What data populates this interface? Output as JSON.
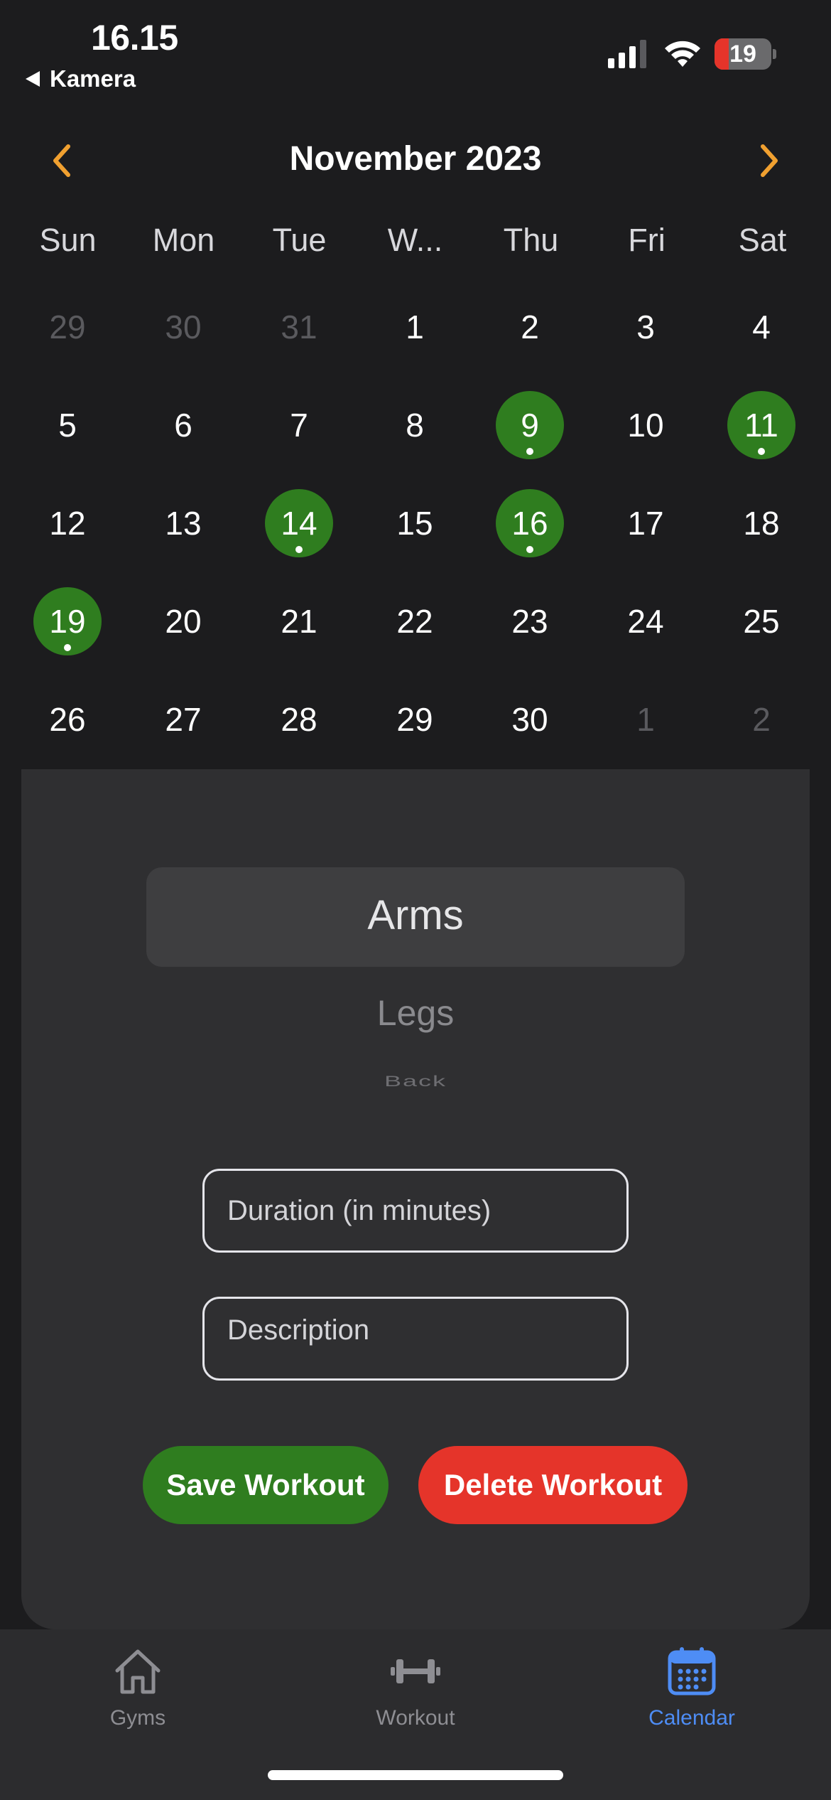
{
  "status_bar": {
    "time": "16.15",
    "back_app": "Kamera",
    "battery_level": "19"
  },
  "calendar": {
    "month_title": "November 2023",
    "accent_color": "#f0a030",
    "weekdays": [
      "Sun",
      "Mon",
      "Tue",
      "W...",
      "Thu",
      "Fri",
      "Sat"
    ],
    "weeks": [
      [
        "29",
        "30",
        "31",
        "1",
        "2",
        "3",
        "4"
      ],
      [
        "5",
        "6",
        "7",
        "8",
        "9",
        "10",
        "11"
      ],
      [
        "12",
        "13",
        "14",
        "15",
        "16",
        "17",
        "18"
      ],
      [
        "19",
        "20",
        "21",
        "22",
        "23",
        "24",
        "25"
      ],
      [
        "26",
        "27",
        "28",
        "29",
        "30",
        "1",
        "2"
      ]
    ],
    "outside_month_days": [
      "29-Oct",
      "30-Oct",
      "31-Oct",
      "1-Dec",
      "2-Dec"
    ],
    "workout_days": [
      "9",
      "11",
      "14",
      "16",
      "19"
    ],
    "workout_color": "#2f7d1f"
  },
  "workout_form": {
    "picker_options": [
      "Arms",
      "Legs",
      "Back"
    ],
    "selected_option": "Arms",
    "duration_placeholder": "Duration (in minutes)",
    "description_placeholder": "Description",
    "save_label": "Save Workout",
    "delete_label": "Delete Workout",
    "save_color": "#2f7d1f",
    "delete_color": "#e5342a"
  },
  "tab_bar": {
    "items": [
      {
        "label": "Gyms",
        "icon": "house-icon",
        "active": false
      },
      {
        "label": "Workout",
        "icon": "dumbbell-icon",
        "active": false
      },
      {
        "label": "Calendar",
        "icon": "calendar-icon",
        "active": true
      }
    ],
    "active_color": "#4e8df5"
  }
}
